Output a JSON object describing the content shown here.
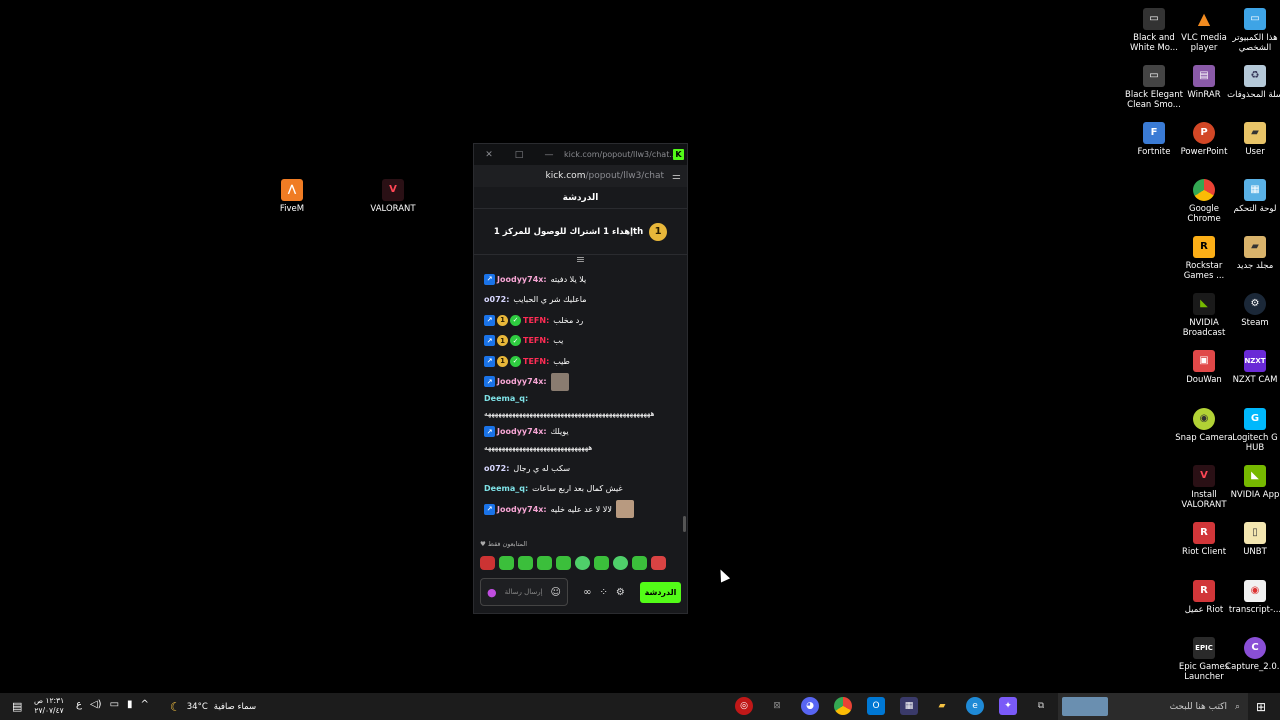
{
  "desktop": {
    "icons": [
      {
        "label": "Black and White Mo...",
        "color": "#333333"
      },
      {
        "label": "VLC media player",
        "color": "#f28b20"
      },
      {
        "label": "هذا الكمبيوتر الشخصي",
        "color": "#3ea4e6"
      },
      {
        "label": "Black Elegant Clean Smo...",
        "color": "#444444"
      },
      {
        "label": "WinRAR",
        "color": "#8a5aa8"
      },
      {
        "label": "سلة المحذوفات",
        "color": "#b5c9d8"
      },
      {
        "label": "Fortnite",
        "color": "#3a7bd5"
      },
      {
        "label": "PowerPoint",
        "color": "#d24726"
      },
      {
        "label": "User",
        "color": "#e8c468"
      },
      {
        "label": "Google Chrome",
        "color": "#4285f4"
      },
      {
        "label": "لوحة التحكم",
        "color": "#5ab1e5"
      },
      {
        "label": "Rockstar Games ...",
        "color": "#fcaf17"
      },
      {
        "label": "مجلد جديد",
        "color": "#d9b36b"
      },
      {
        "label": "NVIDIA Broadcast",
        "color": "#76b900"
      },
      {
        "label": "Steam",
        "color": "#1b2838"
      },
      {
        "label": "DouWan",
        "color": "#e04848"
      },
      {
        "label": "NZXT CAM",
        "color": "#6a2ad6"
      },
      {
        "label": "Snap Camera",
        "color": "#b2d235"
      },
      {
        "label": "Logitech G HUB",
        "color": "#00b8fc"
      },
      {
        "label": "Install VALORANT",
        "color": "#ff4655"
      },
      {
        "label": "NVIDIA App",
        "color": "#76b900"
      },
      {
        "label": "Riot Client",
        "color": "#d13639"
      },
      {
        "label": "UNBT",
        "color": "#f3e6b0"
      },
      {
        "label": "عميل Riot",
        "color": "#d13639"
      },
      {
        "label": "transcript-...",
        "color": "#f1f1f1"
      },
      {
        "label": "Epic Games Launcher",
        "color": "#2a2a2a"
      },
      {
        "label": "Capture_2.0...",
        "color": "#8a4fd6"
      },
      {
        "label": "FiveM",
        "color": "#f07c24"
      },
      {
        "label": "VALORANT",
        "color": "#ff4655"
      }
    ]
  },
  "chat_window": {
    "title": "kick.com/popout/llw3/chat...",
    "url_host": "kick.com",
    "url_path": "/popout/llw3/chat",
    "header": "الدردشة",
    "goal_badge": "1",
    "goal_text": "إهداء 1 اشتراك للوصول للمركز 1th",
    "messages": [
      {
        "user": "Joodyy74x:",
        "text": "يلا يلا دفيته",
        "color": "pink"
      },
      {
        "user": "o072:",
        "text": "ماعليك شر ي الحبايب",
        "color": "white"
      },
      {
        "user": "TEFN:",
        "text": "رد مخلب",
        "color": "red"
      },
      {
        "user": "TEFN:",
        "text": "يب",
        "color": "red"
      },
      {
        "user": "TEFN:",
        "text": "طيب",
        "color": "red"
      },
      {
        "user": "Joodyy74x:",
        "text": "",
        "color": "pink"
      },
      {
        "user": "Deema_q:",
        "text": "ههههههههههههههههههههههههههههههههههههههههههههههههه",
        "color": "teal"
      },
      {
        "user": "Joodyy74x:",
        "text": "يويلك",
        "extra": "ههههههههههههههههههههههههههههههه",
        "color": "pink"
      },
      {
        "user": "o072:",
        "text": "سكب له ي رجال",
        "color": "white"
      },
      {
        "user": "Deema_q:",
        "text": "غيش كمال بعد اربع ساعات",
        "color": "teal"
      },
      {
        "user": "Joodyy74x:",
        "text": "لالا لا عد عليه خليه",
        "color": "pink"
      }
    ],
    "followers_only": "المتابعون فقط",
    "input_placeholder": "إرسال رسالة",
    "send_label": "الدردشة"
  },
  "taskbar": {
    "time": "١٢:٣١ ص",
    "date": "٢٧/٠٧/٤٧",
    "lang": "ع",
    "temperature": "34°C",
    "weather": "سماء صافية",
    "search_placeholder": "اكتب هنا للبحث"
  }
}
